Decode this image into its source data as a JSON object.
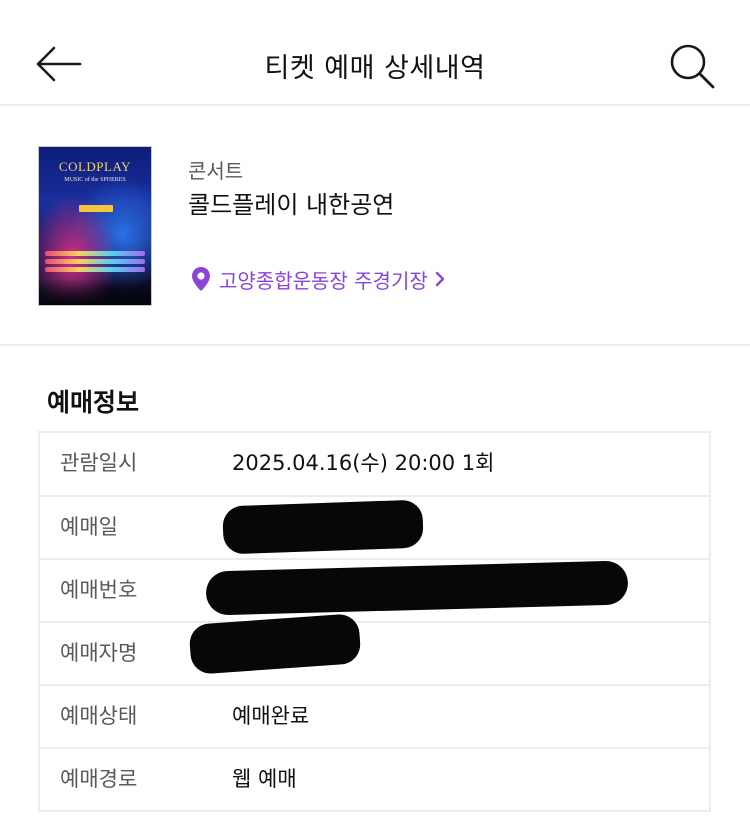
{
  "header": {
    "title": "티켓 예매 상세내역",
    "back_icon": "arrow-left-icon",
    "search_icon": "search-icon"
  },
  "event": {
    "poster": {
      "title_text": "COLDPLAY",
      "subtitle_text": "MUSIC of the SPHERES"
    },
    "category": "콘서트",
    "title": "콜드플레이 내한공연",
    "venue": "고양종합운동장 주경기장",
    "venue_icon": "location-pin-icon",
    "accent_color": "#8b45d8"
  },
  "booking_info": {
    "section_title": "예매정보",
    "rows": [
      {
        "label": "관람일시",
        "value": "2025.04.16(수) 20:00 1회"
      },
      {
        "label": "예매일",
        "value": ""
      },
      {
        "label": "예매번호",
        "value": ""
      },
      {
        "label": "예매자명",
        "value": ""
      },
      {
        "label": "예매상태",
        "value": "예매완료"
      },
      {
        "label": "예매경로",
        "value": "웹 예매"
      }
    ]
  }
}
